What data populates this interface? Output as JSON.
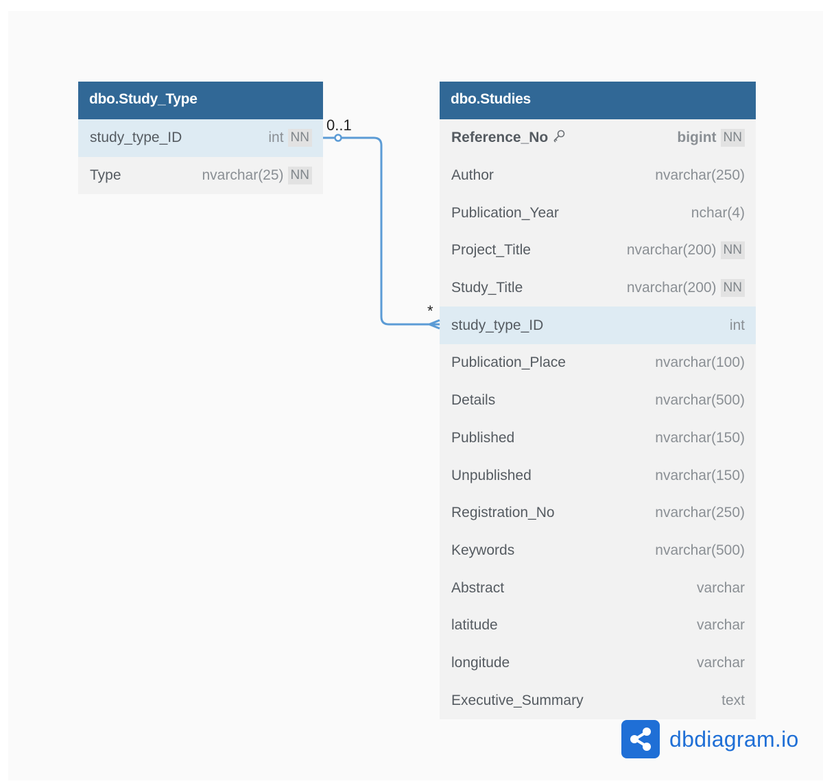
{
  "tables": [
    {
      "name": "dbo.Study_Type",
      "rows": [
        {
          "name": "study_type_ID",
          "type": "int",
          "nn": "NN",
          "highlight": true
        },
        {
          "name": "Type",
          "type": "nvarchar(25)",
          "nn": "NN"
        }
      ]
    },
    {
      "name": "dbo.Studies",
      "rows": [
        {
          "name": "Reference_No",
          "type": "bigint",
          "nn": "NN",
          "pk": true,
          "icon": "key-icon"
        },
        {
          "name": "Author",
          "type": "nvarchar(250)"
        },
        {
          "name": "Publication_Year",
          "type": "nchar(4)"
        },
        {
          "name": "Project_Title",
          "type": "nvarchar(200)",
          "nn": "NN"
        },
        {
          "name": "Study_Title",
          "type": "nvarchar(200)",
          "nn": "NN"
        },
        {
          "name": "study_type_ID",
          "type": "int",
          "highlight": true
        },
        {
          "name": "Publication_Place",
          "type": "nvarchar(100)"
        },
        {
          "name": "Details",
          "type": "nvarchar(500)"
        },
        {
          "name": "Published",
          "type": "nvarchar(150)"
        },
        {
          "name": "Unpublished",
          "type": "nvarchar(150)"
        },
        {
          "name": "Registration_No",
          "type": "nvarchar(250)"
        },
        {
          "name": "Keywords",
          "type": "nvarchar(500)"
        },
        {
          "name": "Abstract",
          "type": "varchar"
        },
        {
          "name": "latitude",
          "type": "varchar"
        },
        {
          "name": "longitude",
          "type": "varchar"
        },
        {
          "name": "Executive_Summary",
          "type": "text"
        }
      ]
    }
  ],
  "relationship": {
    "from_label": "0..1",
    "to_label": "*",
    "color": "#5b9bd5"
  },
  "logo": {
    "text": "dbdiagram.io",
    "icon": "share-nodes-icon",
    "color": "#1f6fd6"
  },
  "colors": {
    "header": "#316896",
    "highlight_row": "#deebf3",
    "table_body": "#f2f2f2"
  }
}
